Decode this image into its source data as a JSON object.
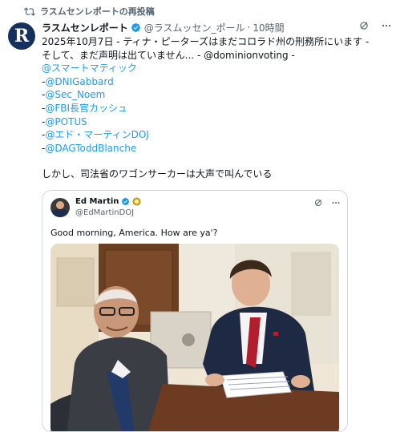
{
  "repost_label": "ラスムセンレポートの再投稿",
  "author": {
    "initial": "R",
    "name": "ラスムセンレポート",
    "handle": "@ラスムッセン_ポール",
    "separator": "·",
    "time": "10時間"
  },
  "body": {
    "line1": "2025年10月7日 - ティナ・ピーターズはまだコロラド州の刑務所にいます -",
    "line2": "そして、まだ声明は出ていません... - @dominionvoting -",
    "mentions": [
      {
        "prefix": "",
        "text": "@スマートマティック"
      },
      {
        "prefix": "-",
        "text": "@DNIGabbard"
      },
      {
        "prefix": "-",
        "text": "@Sec_Noem"
      },
      {
        "prefix": "-",
        "text": "@FBI長官カッシュ"
      },
      {
        "prefix": "-",
        "text": "@POTUS"
      },
      {
        "prefix": "-",
        "text": "@エド・マーティンDOJ"
      },
      {
        "prefix": "-",
        "text": "@DAGToddBlanche"
      }
    ],
    "closing": "しかし、司法省のワゴンサーカーは大声で叫んでいる"
  },
  "quoted": {
    "name": "Ed Martin",
    "handle": "@EdMartinDOJ",
    "text": "Good morning, America. How are ya'?"
  },
  "colors": {
    "link": "#1d9bf0",
    "verified": "#1d9bf0",
    "muted": "#536471",
    "avatar_bg": "#14315d"
  },
  "icons": [
    "repost-icon",
    "verified-badge-icon",
    "grok-icon",
    "more-icon",
    "gold-badge-icon"
  ]
}
